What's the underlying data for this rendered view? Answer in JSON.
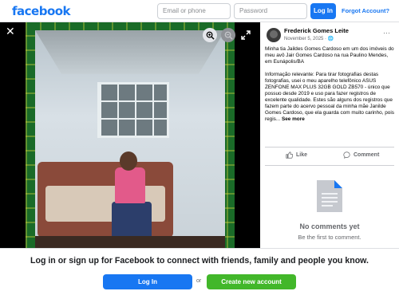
{
  "header": {
    "logo_text": "facebook",
    "email_placeholder": "Email or phone",
    "password_placeholder": "Password",
    "login_label": "Log In",
    "forgot_label": "Forgot Account?"
  },
  "viewer": {
    "close_icon": "close-icon",
    "zoom_in_icon": "zoom-in-icon",
    "zoom_out_icon": "zoom-out-icon",
    "expand_icon": "expand-icon"
  },
  "post": {
    "author": "Frederick Gomes Leite",
    "date": "November 5, 2025 · 🌐",
    "paragraph1": "Minha tia Jaildes Gomes Cardoso em um dos imóveis do meu avô Jair Gomes Cardoso na rua Paulino Mendes, em Eunápolis/BA",
    "paragraph2": "Informação relevante: Para tirar fotografias destas fotografias, usei o meu aparelho telefônico ASUS ZENFONE MAX PLUS 32GB GOLD ZB570 - único que possuo desde 2019 e uso para fazer registros de excelente qualidade. Estes são alguns dos registros que fazem parte do acervo pessoal da minha mãe Janilde Gomes Cardoso, que ela guarda com muito carinho, pois regis...",
    "see_more": "See more",
    "like_label": "Like",
    "comment_label": "Comment"
  },
  "comments": {
    "empty_title": "No comments yet",
    "empty_subtitle": "Be the first to comment."
  },
  "footer": {
    "cta": "Log in or sign up for Facebook to connect with friends, family and people you know.",
    "login_label": "Log In",
    "or_label": "or",
    "create_label": "Create new account"
  },
  "colors": {
    "brand": "#1877f2",
    "create_green": "#42b72a"
  }
}
